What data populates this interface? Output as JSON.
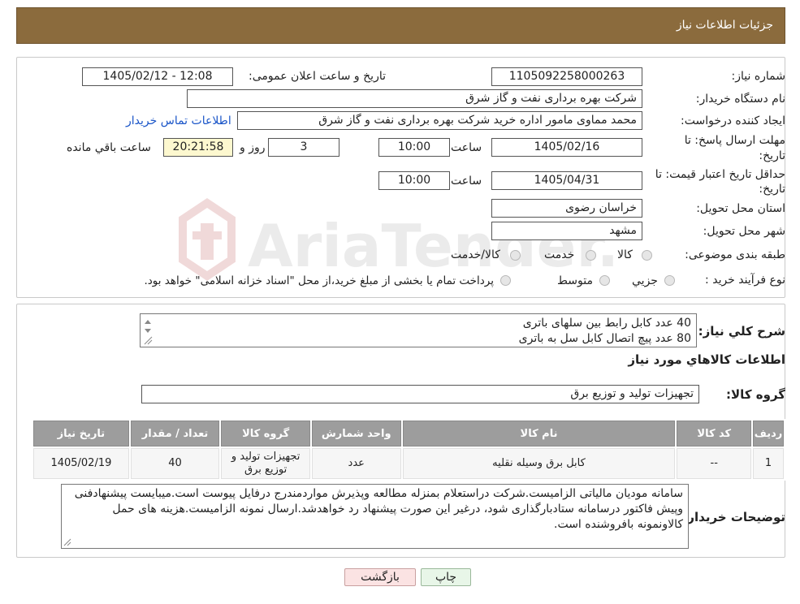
{
  "header": {
    "title": "جزئیات اطلاعات نیاز"
  },
  "form": {
    "need_number_label": "شماره نیاز:",
    "need_number": "1105092258000263",
    "announce_label": "تاریخ و ساعت اعلان عمومی:",
    "announce_value": "1405/02/12 - 12:08",
    "buyer_label": "نام دستگاه خریدار:",
    "buyer_value": "شرکت بهره برداری نفت و گاز شرق",
    "creator_label": "ایجاد کننده درخواست:",
    "creator_value": "محمد مماوی مامور اداره خرید شرکت بهره برداری نفت و گاز شرق",
    "contact_link": "اطلاعات تماس خریدار",
    "deadline_label_1": "مهلت ارسال پاسخ: تا",
    "deadline_label_2": "تاریخ:",
    "deadline_date": "1405/02/16",
    "time_label": "ساعت",
    "deadline_time": "10:00",
    "days_value": "3",
    "days_label": "روز و",
    "remaining_value": "20:21:58",
    "remaining_label": "ساعت باقي مانده",
    "validity_label_1": "حداقل تاریخ اعتبار قیمت: تا",
    "validity_label_2": "تاریخ:",
    "validity_date": "1405/04/31",
    "validity_time": "10:00",
    "province_label": "استان محل تحویل:",
    "province_value": "خراسان رضوی",
    "city_label": "شهر محل تحویل:",
    "city_value": "مشهد",
    "category_label": "طبقه بندی موضوعی:",
    "category_options": [
      "کالا",
      "خدمت",
      "کالا/خدمت"
    ],
    "process_label": "نوع فرآیند خرید :",
    "process_options": [
      "جزیي",
      "متوسط"
    ],
    "process_note": "پرداخت تمام یا بخشی از مبلغ خرید،از محل \"اسناد خزانه اسلامی\" خواهد بود."
  },
  "watermark_text": "AriaTender.neT",
  "summary": {
    "label": "شرح کلي نياز:",
    "lines": [
      "40 عدد کابل رابط بین سلهای باتری",
      "80 عدد پیچ اتصال کابل سل به باتری"
    ]
  },
  "goods_info_title": "اطلاعات کالاهاي مورد نياز",
  "goods_group": {
    "label": "گروه کالا:",
    "value": "تجهیزات تولید و توزیع برق"
  },
  "table": {
    "headers": [
      "رديف",
      "کد کالا",
      "نام کالا",
      "واحد شمارش",
      "گروه کالا",
      "تعداد / مقدار",
      "تاریخ نیاز"
    ],
    "rows": [
      [
        "1",
        "--",
        "کابل برق وسیله نقلیه",
        "عدد",
        "تجهیزات تولید و توزیع برق",
        "40",
        "1405/02/19"
      ]
    ]
  },
  "buyer_notes": {
    "label": "توضیحات خریدار:",
    "text": "سامانه مودیان مالیاتی الزامیست.شرکت دراستعلام بمنزله مطالعه وپذیرش مواردمندرج درفایل پیوست است.میبایست پیشنهادفنی وپیش فاکتور درسامانه ستادبارگذاری شود، درغیر این صورت پیشنهاد رد خواهدشد.ارسال نمونه الزامیست.هزینه های حمل کالاونمونه بافروشنده است."
  },
  "buttons": {
    "print": "چاپ",
    "back": "بازگشت"
  }
}
